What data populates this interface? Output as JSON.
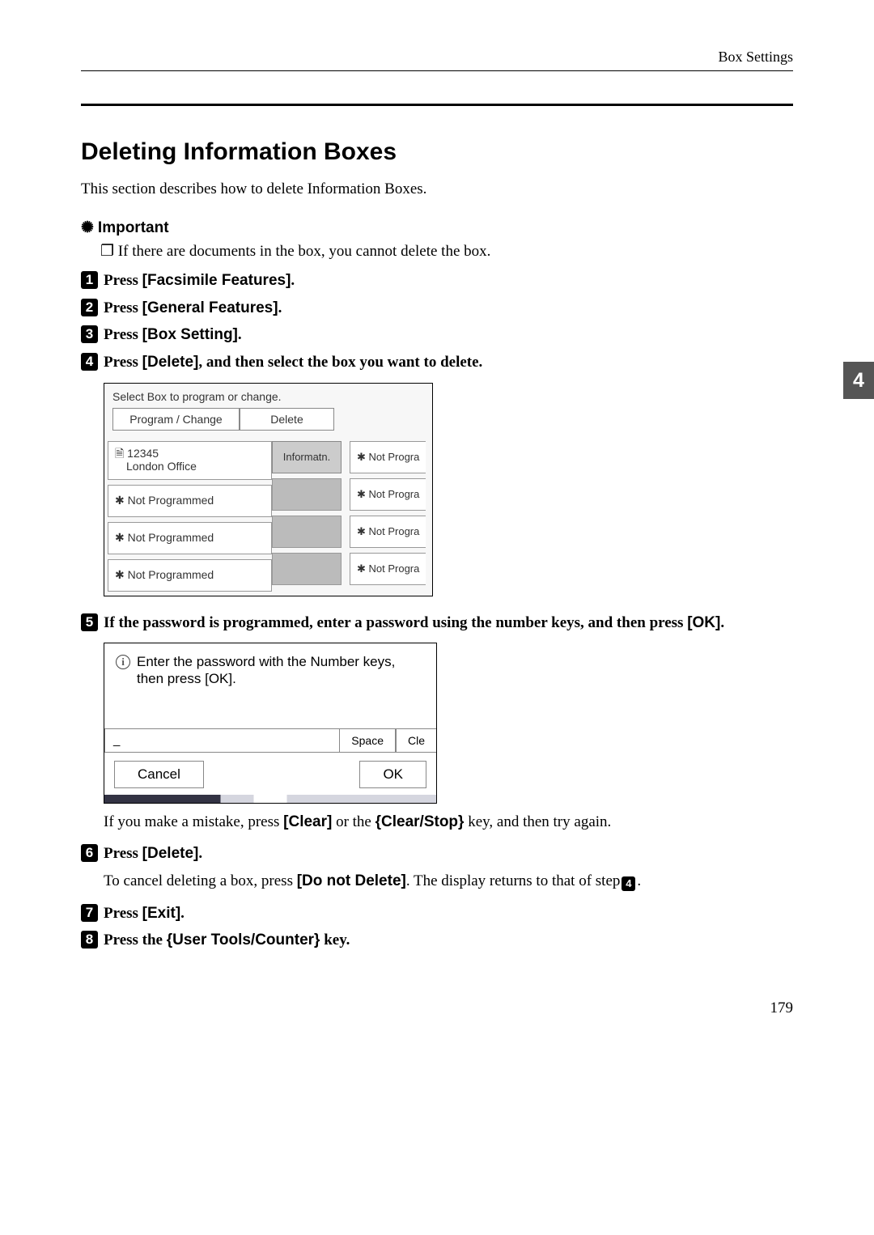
{
  "header": {
    "breadcrumb": "Box Settings"
  },
  "section": {
    "title": "Deleting Information Boxes",
    "intro": "This section describes how to delete Information Boxes."
  },
  "important": {
    "label": "Important",
    "note": "If there are documents in the box, you cannot delete the box."
  },
  "steps": {
    "s1": {
      "num": "1",
      "a": "Press ",
      "b": "[Facsimile Features]",
      "c": "."
    },
    "s2": {
      "num": "2",
      "a": "Press ",
      "b": "[General Features]",
      "c": "."
    },
    "s3": {
      "num": "3",
      "a": "Press ",
      "b": "[Box Setting]",
      "c": "."
    },
    "s4": {
      "num": "4",
      "a": "Press ",
      "b": "[Delete]",
      "c": ", and then select the box you want to delete."
    },
    "s5": {
      "num": "5",
      "a": "If the password is programmed, enter a password using the number keys, and then press ",
      "b": "[OK]",
      "c": "."
    },
    "s6": {
      "num": "6",
      "a": "Press ",
      "b": "[Delete]",
      "c": "."
    },
    "s7": {
      "num": "7",
      "a": "Press ",
      "b": "[Exit]",
      "c": "."
    },
    "s8": {
      "num": "8",
      "a": "Press the ",
      "b": "{User Tools/Counter}",
      "c": " key."
    }
  },
  "ui1": {
    "prompt": "Select Box to program or change.",
    "tab1": "Program / Change",
    "tab2": "Delete",
    "row1_code": "12345",
    "row1_name": "London Office",
    "row1_type": "Informatn.",
    "not_programmed": "✱ Not Programmed",
    "not_progra": "✱ Not Progra"
  },
  "ui2": {
    "prompt": "Enter the password with the Number keys, then press [OK].",
    "underscore": "_",
    "space_btn": "Space",
    "clear_btn": "Cle",
    "cancel_btn": "Cancel",
    "ok_btn": "OK"
  },
  "post5": {
    "a": "If you make a mistake, press ",
    "b": "[Clear]",
    "c": " or the ",
    "d": "{Clear/Stop}",
    "e": " key, and then try again."
  },
  "post6": {
    "a": "To cancel deleting a box, press ",
    "b": "[Do not Delete]",
    "c": ". The display returns to that of step",
    "num": "4",
    "d": "."
  },
  "tab_badge": "4",
  "page_number": "179"
}
